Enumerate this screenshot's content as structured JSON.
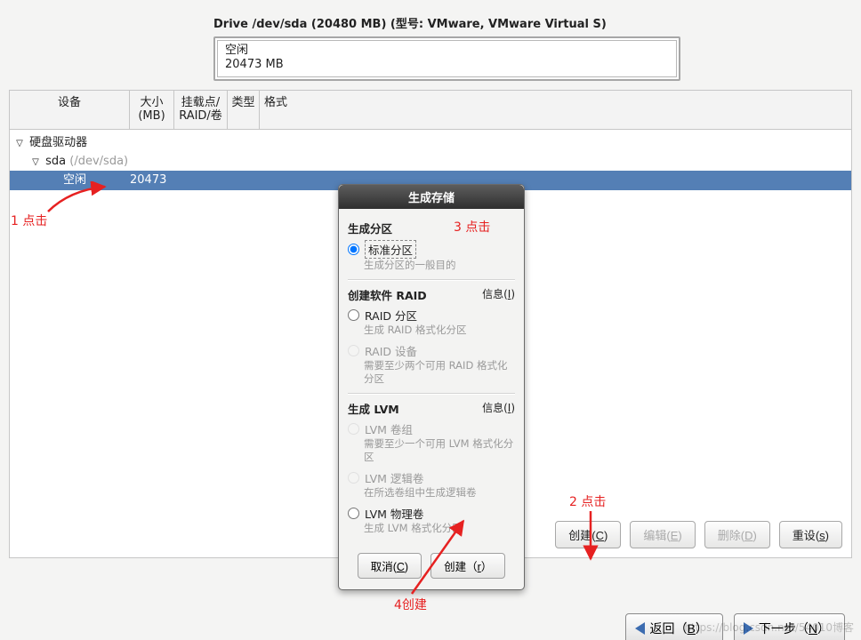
{
  "drive": {
    "title": "Drive /dev/sda (20480 MB) (型号: VMware, VMware Virtual S)",
    "free_label": "空闲",
    "free_size": "20473 MB"
  },
  "columns": {
    "device": "设备",
    "size_line1": "大小",
    "size_line2": "(MB)",
    "mount_line1": "挂载点/",
    "mount_line2": "RAID/卷",
    "type": "类型",
    "format": "格式"
  },
  "tree": {
    "root": "硬盘驱动器",
    "sda_label": "sda",
    "sda_path": "(/dev/sda)",
    "free_label": "空闲",
    "free_size": "20473"
  },
  "panel_buttons": {
    "create": "创建",
    "create_key": "C",
    "edit": "编辑",
    "edit_key": "E",
    "delete": "删除",
    "delete_key": "D",
    "reset": "重设",
    "reset_key": "s"
  },
  "nav": {
    "back": "返回",
    "back_key": "B",
    "next": "下一步",
    "next_key": "N"
  },
  "dialog": {
    "title": "生成存储",
    "sec_partition": "生成分区",
    "opt_std_partition": "标准分区",
    "opt_std_desc": "生成分区的一般目的",
    "sec_raid": "创建软件 RAID",
    "info_label": "信息",
    "info_key": "I",
    "opt_raid_part": "RAID 分区",
    "opt_raid_part_desc": "生成 RAID 格式化分区",
    "opt_raid_dev": "RAID 设备",
    "opt_raid_dev_desc": "需要至少两个可用 RAID 格式化分区",
    "sec_lvm": "生成 LVM",
    "opt_lvm_vg": "LVM 卷组",
    "opt_lvm_vg_desc": "需要至少一个可用 LVM 格式化分区",
    "opt_lvm_lv": "LVM 逻辑卷",
    "opt_lvm_lv_desc": "在所选卷组中生成逻辑卷",
    "opt_lvm_pv": "LVM 物理卷",
    "opt_lvm_pv_desc": "生成 LVM 格式化分区",
    "cancel": "取消",
    "cancel_key": "C",
    "create": "创建",
    "create_key": "r"
  },
  "annotations": {
    "a1": "1 点击",
    "a2": "2 点击",
    "a3": "3 点击",
    "a4": "4创建"
  },
  "watermark": "https://blog.csdn.net/54010博客"
}
